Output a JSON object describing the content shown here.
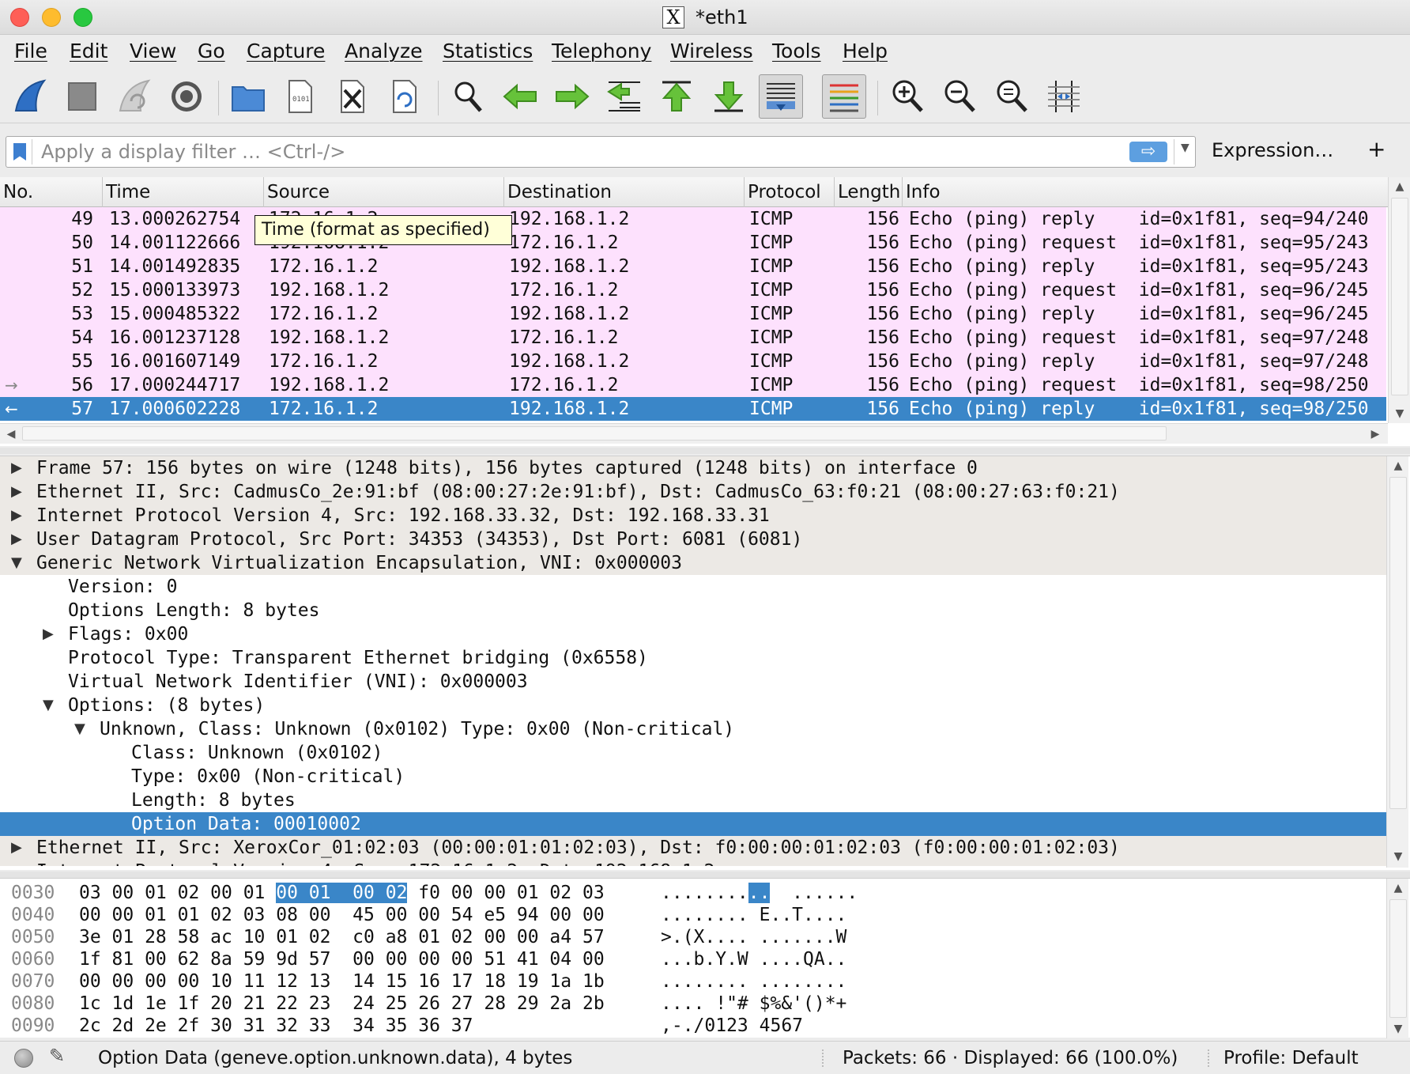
{
  "window": {
    "title": "*eth1"
  },
  "menu": [
    "File",
    "Edit",
    "View",
    "Go",
    "Capture",
    "Analyze",
    "Statistics",
    "Telephony",
    "Wireless",
    "Tools",
    "Help"
  ],
  "toolbar": {
    "icons": [
      "shark-fin-start-icon",
      "stop-square-icon",
      "restart-capture-icon",
      "capture-options-gear-icon",
      "open-folder-icon",
      "save-file-icon",
      "close-file-icon",
      "reload-file-icon",
      "find-packet-magnifier-icon",
      "go-back-arrow-icon",
      "go-forward-arrow-icon",
      "go-to-packet-icon",
      "go-first-packet-icon",
      "go-last-packet-icon",
      "autoscroll-icon",
      "colorize-icon",
      "zoom-in-icon",
      "zoom-out-icon",
      "zoom-normal-icon",
      "resize-columns-icon"
    ]
  },
  "filter": {
    "placeholder": "Apply a display filter … <Ctrl-/>",
    "value": "",
    "apply_glyph": "⇨",
    "dropdown_glyph": "▼",
    "expression_label": "Expression…",
    "add_label": "+"
  },
  "packet_list": {
    "columns": [
      "No.",
      "Time",
      "Source",
      "Destination",
      "Protocol",
      "Length",
      "Info"
    ],
    "rows": [
      {
        "marker": "",
        "no": "49",
        "time": "13.000262754",
        "src": "172.16.1.2",
        "dst": "192.168.1.2",
        "proto": "ICMP",
        "len": "156",
        "info": "Echo (ping) reply    id=0x1f81, seq=94/240"
      },
      {
        "marker": "",
        "no": "50",
        "time": "14.001122666",
        "src": "192.168.1.2",
        "dst": "172.16.1.2",
        "proto": "ICMP",
        "len": "156",
        "info": "Echo (ping) request  id=0x1f81, seq=95/243"
      },
      {
        "marker": "",
        "no": "51",
        "time": "14.001492835",
        "src": "172.16.1.2",
        "dst": "192.168.1.2",
        "proto": "ICMP",
        "len": "156",
        "info": "Echo (ping) reply    id=0x1f81, seq=95/243"
      },
      {
        "marker": "",
        "no": "52",
        "time": "15.000133973",
        "src": "192.168.1.2",
        "dst": "172.16.1.2",
        "proto": "ICMP",
        "len": "156",
        "info": "Echo (ping) request  id=0x1f81, seq=96/245"
      },
      {
        "marker": "",
        "no": "53",
        "time": "15.000485322",
        "src": "172.16.1.2",
        "dst": "192.168.1.2",
        "proto": "ICMP",
        "len": "156",
        "info": "Echo (ping) reply    id=0x1f81, seq=96/245"
      },
      {
        "marker": "",
        "no": "54",
        "time": "16.001237128",
        "src": "192.168.1.2",
        "dst": "172.16.1.2",
        "proto": "ICMP",
        "len": "156",
        "info": "Echo (ping) request  id=0x1f81, seq=97/248"
      },
      {
        "marker": "",
        "no": "55",
        "time": "16.001607149",
        "src": "172.16.1.2",
        "dst": "192.168.1.2",
        "proto": "ICMP",
        "len": "156",
        "info": "Echo (ping) reply    id=0x1f81, seq=97/248"
      },
      {
        "marker": "→",
        "no": "56",
        "time": "17.000244717",
        "src": "192.168.1.2",
        "dst": "172.16.1.2",
        "proto": "ICMP",
        "len": "156",
        "info": "Echo (ping) request  id=0x1f81, seq=98/250"
      },
      {
        "marker": "←",
        "no": "57",
        "time": "17.000602228",
        "src": "172.16.1.2",
        "dst": "192.168.1.2",
        "proto": "ICMP",
        "len": "156",
        "info": "Echo (ping) reply    id=0x1f81, seq=98/250"
      }
    ],
    "selected_no": "57",
    "row_color": "#fde1fd",
    "selected_color": "#3a86c8"
  },
  "tooltip": "Time (format as specified)",
  "details": [
    {
      "indent": 0,
      "expander": "collapsed",
      "text": "Frame 57: 156 bytes on wire (1248 bits), 156 bytes captured (1248 bits) on interface 0"
    },
    {
      "indent": 0,
      "expander": "collapsed",
      "text": "Ethernet II, Src: CadmusCo_2e:91:bf (08:00:27:2e:91:bf), Dst: CadmusCo_63:f0:21 (08:00:27:63:f0:21)"
    },
    {
      "indent": 0,
      "expander": "collapsed",
      "text": "Internet Protocol Version 4, Src: 192.168.33.32, Dst: 192.168.33.31"
    },
    {
      "indent": 0,
      "expander": "collapsed",
      "text": "User Datagram Protocol, Src Port: 34353 (34353), Dst Port: 6081 (6081)"
    },
    {
      "indent": 0,
      "expander": "expanded",
      "text": "Generic Network Virtualization Encapsulation, VNI: 0x000003"
    },
    {
      "indent": 1,
      "expander": "none",
      "text": "Version: 0"
    },
    {
      "indent": 1,
      "expander": "none",
      "text": "Options Length: 8 bytes"
    },
    {
      "indent": 1,
      "expander": "collapsed",
      "text": "Flags: 0x00"
    },
    {
      "indent": 1,
      "expander": "none",
      "text": "Protocol Type: Transparent Ethernet bridging (0x6558)"
    },
    {
      "indent": 1,
      "expander": "none",
      "text": "Virtual Network Identifier (VNI): 0x000003"
    },
    {
      "indent": 1,
      "expander": "expanded",
      "text": "Options: (8 bytes)"
    },
    {
      "indent": 2,
      "expander": "expanded",
      "text": "Unknown, Class: Unknown (0x0102) Type: 0x00 (Non-critical)"
    },
    {
      "indent": 3,
      "expander": "none",
      "text": "Class: Unknown (0x0102)"
    },
    {
      "indent": 3,
      "expander": "none",
      "text": "Type: 0x00 (Non-critical)"
    },
    {
      "indent": 3,
      "expander": "none",
      "text": "Length: 8 bytes"
    },
    {
      "indent": 3,
      "expander": "none",
      "text": "Option Data: 00010002",
      "selected": true
    },
    {
      "indent": 0,
      "expander": "collapsed",
      "text": "Ethernet II, Src: XeroxCor_01:02:03 (00:00:01:01:02:03), Dst: f0:00:00:01:02:03 (f0:00:00:01:02:03)"
    },
    {
      "indent": 0,
      "expander": "collapsed",
      "text": "Internet Protocol Version 4, Src: 172.16.1.2, Dst: 192.168.1.2"
    }
  ],
  "bytes": [
    {
      "offset": "0030",
      "hex": [
        "03 00 01 02 00 01 ",
        "00 01  00 02",
        " f0 00 00 01 02 03"
      ],
      "ascii": [
        "........",
        "..",
        "  ......"
      ],
      "hl": true
    },
    {
      "offset": "0040",
      "hex": "00 00 01 01 02 03 08 00  45 00 00 54 e5 94 00 00",
      "ascii": "........ E..T...."
    },
    {
      "offset": "0050",
      "hex": "3e 01 28 58 ac 10 01 02  c0 a8 01 02 00 00 a4 57",
      "ascii": ">.(X.... .......W"
    },
    {
      "offset": "0060",
      "hex": "1f 81 00 62 8a 59 9d 57  00 00 00 00 51 41 04 00",
      "ascii": "...b.Y.W ....QA.."
    },
    {
      "offset": "0070",
      "hex": "00 00 00 00 10 11 12 13  14 15 16 17 18 19 1a 1b",
      "ascii": "........ ........"
    },
    {
      "offset": "0080",
      "hex": "1c 1d 1e 1f 20 21 22 23  24 25 26 27 28 29 2a 2b",
      "ascii": ".... !\"# $%&'()*+"
    },
    {
      "offset": "0090",
      "hex": "2c 2d 2e 2f 30 31 32 33  34 35 36 37",
      "ascii": ",-./0123 4567"
    }
  ],
  "status": {
    "message": "Option Data (geneve.option.unknown.data), 4 bytes",
    "packets": "Packets: 66 · Displayed: 66 (100.0%)",
    "profile": "Profile: Default"
  }
}
